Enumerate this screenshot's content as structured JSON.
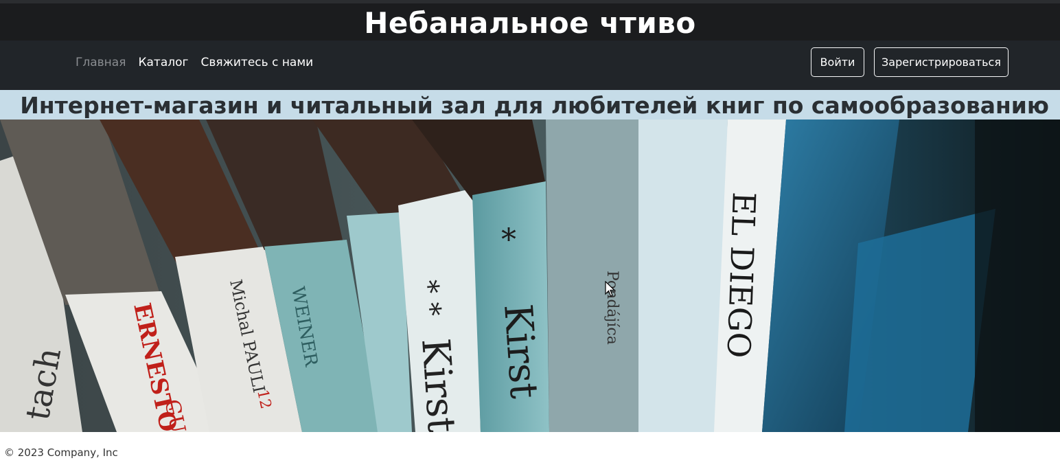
{
  "site": {
    "title": "Небанальное чтиво"
  },
  "nav": {
    "items": [
      {
        "label": "Главная",
        "active": true
      },
      {
        "label": "Каталог",
        "active": false
      },
      {
        "label": "Свяжитесь с нами",
        "active": false
      }
    ],
    "login_label": "Войти",
    "register_label": "Зарегистрироваться"
  },
  "hero": {
    "heading": "Интернет-магазин и читальный зал для любителей книг по самообразованию",
    "spine_texts": [
      "tach",
      "ERNESTO",
      "GU",
      "Michal PAULI",
      "12",
      "WEINER",
      "* *",
      "Kirst",
      "*",
      "Kirst",
      "Pondájíca",
      "EL DIEGO"
    ]
  },
  "footer": {
    "copyright": "© 2023 Company, Inc"
  },
  "colors": {
    "header_bg": "#1b1c1e",
    "navbar_bg": "#212529",
    "hero_heading_bg": "#c6dce8",
    "nav_active": "#8a8d91"
  }
}
